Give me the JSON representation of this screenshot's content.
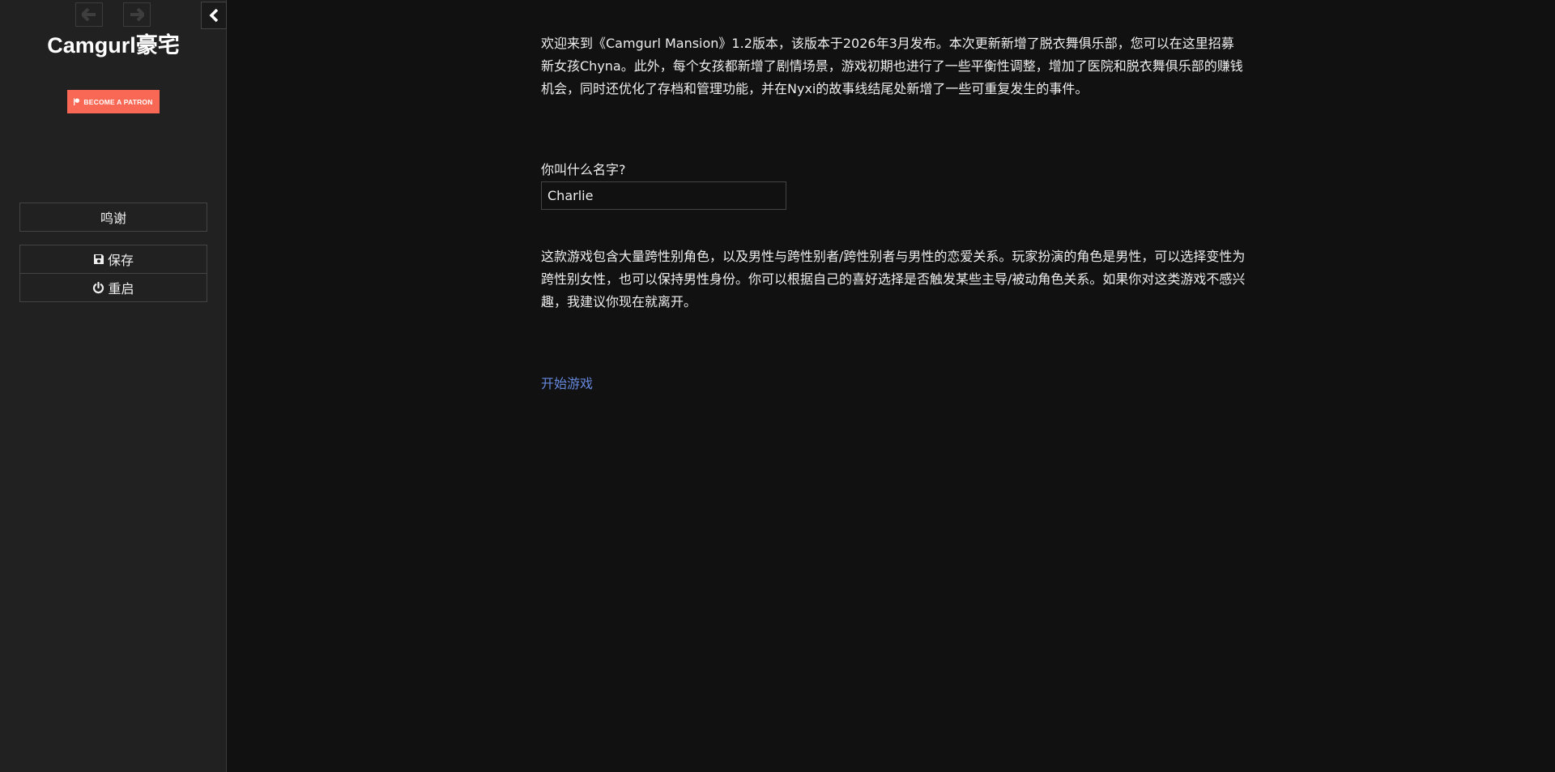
{
  "sidebar": {
    "title": "Camgurl豪宅",
    "patron_label": "BECOME A PATRON",
    "credits_label": "鸣谢",
    "save_label": "保存",
    "restart_label": "重启"
  },
  "passage": {
    "intro": "欢迎来到《Camgurl Mansion》1.2版本，该版本于2026年3月发布。本次更新新增了脱衣舞俱乐部，您可以在这里招募新女孩Chyna。此外，每个女孩都新增了剧情场景，游戏初期也进行了一些平衡性调整，增加了医院和脱衣舞俱乐部的赚钱机会，同时还优化了存档和管理功能，并在Nyxi的故事线结尾处新增了一些可重复发生的事件。",
    "name_prompt": "你叫什么名字?",
    "name_value": "Charlie",
    "warning": "这款游戏包含大量跨性别角色，以及男性与跨性别者/跨性别者与男性的恋爱关系。玩家扮演的角色是男性，可以选择变性为跨性别女性，也可以保持男性身份。你可以根据自己的喜好选择是否触发某些主导/被动角色关系。如果你对这类游戏不感兴趣，我建议你现在就离开。",
    "start_link": "开始游戏"
  },
  "colors": {
    "background": "#111111",
    "sidebar": "#212121",
    "patron": "#f96854",
    "link": "#6688dd"
  },
  "icons": [
    "arrow-left-icon",
    "arrow-right-icon",
    "chevron-left-icon",
    "patreon-logo-icon",
    "save-icon",
    "power-icon"
  ]
}
